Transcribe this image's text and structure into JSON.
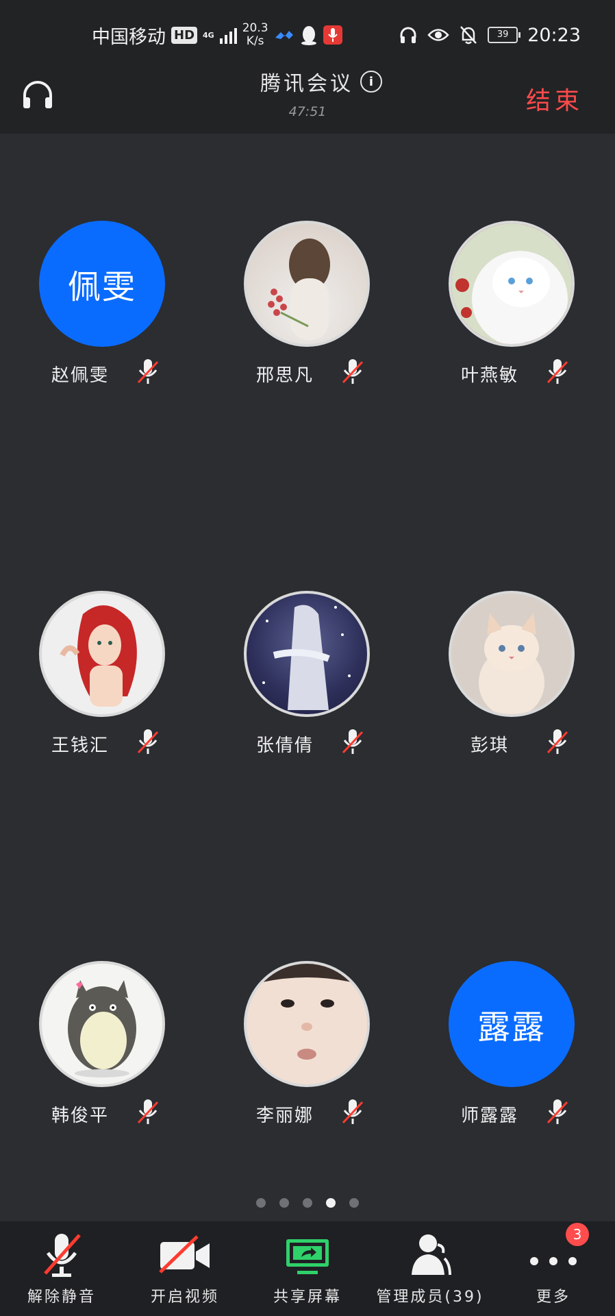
{
  "status_bar": {
    "carrier": "中国移动",
    "hd": "HD",
    "network": "4G",
    "speed_value": "20.3",
    "speed_unit": "K/s",
    "battery": "39",
    "time": "20:23"
  },
  "header": {
    "title": "腾讯会议",
    "timer": "47:51",
    "end_label": "结束"
  },
  "participants": [
    {
      "name": "赵佩雯",
      "avatar_text": "佩雯",
      "avatar_type": "text",
      "muted": true
    },
    {
      "name": "邢思凡",
      "avatar_type": "photo",
      "muted": true
    },
    {
      "name": "叶燕敏",
      "avatar_type": "photo",
      "muted": true
    },
    {
      "name": "王钱汇",
      "avatar_type": "photo",
      "muted": true
    },
    {
      "name": "张倩倩",
      "avatar_type": "photo",
      "muted": true
    },
    {
      "name": "彭琪",
      "avatar_type": "photo",
      "muted": true
    },
    {
      "name": "韩俊平",
      "avatar_type": "photo",
      "muted": true
    },
    {
      "name": "李丽娜",
      "avatar_type": "photo",
      "muted": true
    },
    {
      "name": "师露露",
      "avatar_text": "露露",
      "avatar_type": "text",
      "muted": true
    }
  ],
  "pagination": {
    "total": 5,
    "current": 4
  },
  "toolbar": {
    "unmute_label": "解除静音",
    "video_label": "开启视频",
    "share_label": "共享屏幕",
    "members_label": "管理成员(39)",
    "more_label": "更多",
    "more_badge": "3"
  },
  "colors": {
    "background": "#2b2d31",
    "header": "#222325",
    "toolbar": "#1f2023",
    "accent_blue": "#0a6cff",
    "end_red": "#ff4a4a",
    "mute_slash_red": "#ff3b30",
    "share_green": "#2fd16a",
    "badge_red": "#ff4d4d"
  }
}
